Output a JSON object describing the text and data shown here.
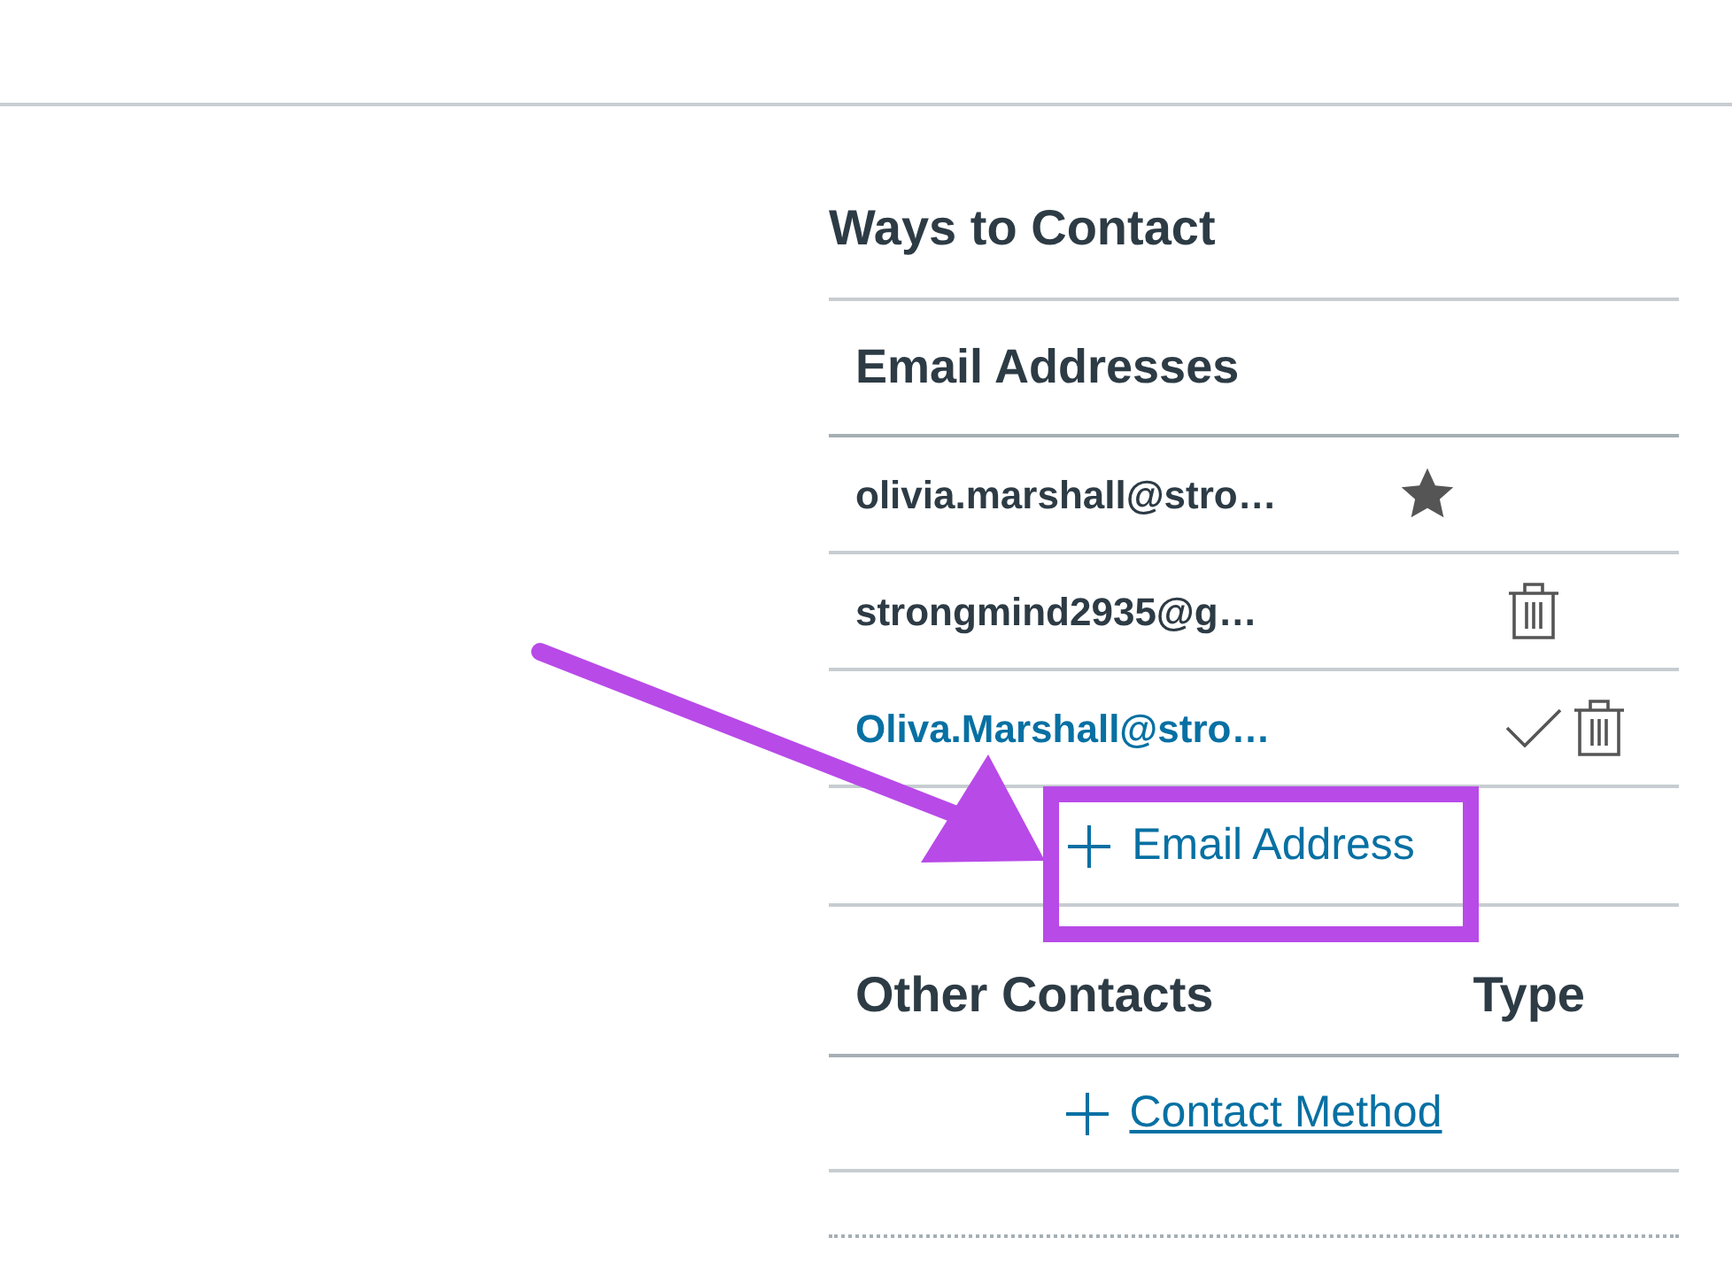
{
  "title": "Ways to Contact",
  "emails": {
    "heading": "Email Addresses",
    "rows": [
      {
        "address": "olivia.marshall@stro…",
        "kind": "default"
      },
      {
        "address": "strongmind2935@g…",
        "kind": "removable"
      },
      {
        "address": "Oliva.Marshall@stro…",
        "kind": "unconfirmed"
      }
    ],
    "add_label": "Email Address"
  },
  "other_contacts": {
    "heading": "Other Contacts",
    "type_heading": "Type",
    "add_label": "Contact Method"
  }
}
